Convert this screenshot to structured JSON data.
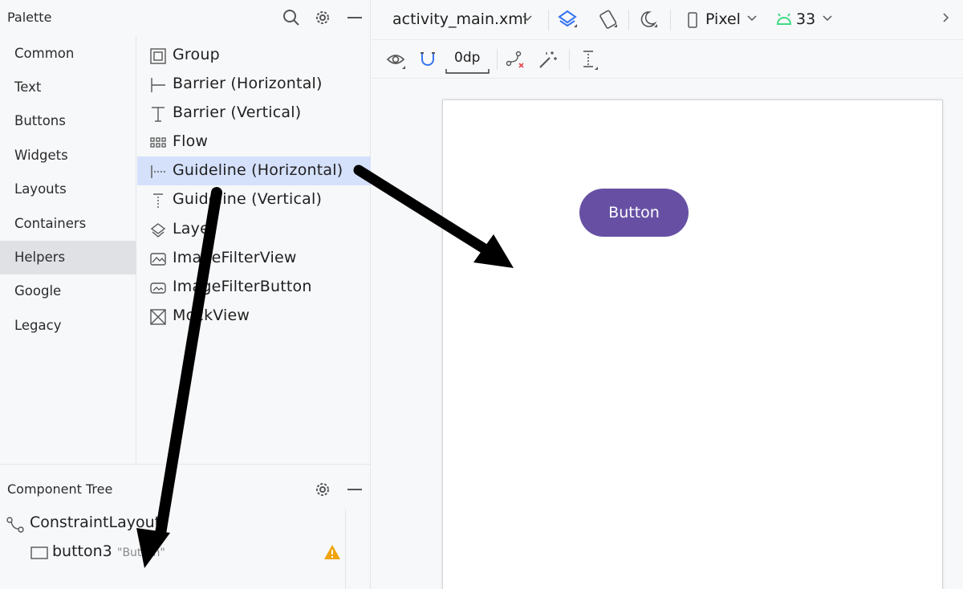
{
  "palette": {
    "title": "Palette",
    "categories": [
      "Common",
      "Text",
      "Buttons",
      "Widgets",
      "Layouts",
      "Containers",
      "Helpers",
      "Google",
      "Legacy"
    ],
    "selected_category": "Helpers",
    "widgets": [
      {
        "label": "Group",
        "icon": "group-icon"
      },
      {
        "label": "Barrier (Horizontal)",
        "icon": "barrier-horizontal-icon"
      },
      {
        "label": "Barrier (Vertical)",
        "icon": "barrier-vertical-icon"
      },
      {
        "label": "Flow",
        "icon": "flow-icon"
      },
      {
        "label": "Guideline (Horizontal)",
        "icon": "guideline-horizontal-icon"
      },
      {
        "label": "Guideline (Vertical)",
        "icon": "guideline-vertical-icon"
      },
      {
        "label": "Layer",
        "icon": "layer-icon"
      },
      {
        "label": "ImageFilterView",
        "icon": "image-filter-view-icon"
      },
      {
        "label": "ImageFilterButton",
        "icon": "image-filter-button-icon"
      },
      {
        "label": "MockView",
        "icon": "mockview-icon"
      }
    ],
    "selected_widget": "Guideline (Horizontal)"
  },
  "component_tree": {
    "title": "Component Tree",
    "root": "ConstraintLayout",
    "children": [
      {
        "label": "button3",
        "text": "\"Button\"",
        "warning": true
      }
    ]
  },
  "toolbar": {
    "file": "activity_main.xml",
    "device": "Pixel",
    "api_level": "33",
    "margin": "0dp"
  },
  "design": {
    "button_text": "Button"
  },
  "colors": {
    "accent": "#6750a4",
    "selection": "#d5e1fb",
    "category_selected": "#dfe1e5",
    "warning": "#f0a30a",
    "android_green": "#3ddc84",
    "blueprint_blue": "#3574f0"
  }
}
